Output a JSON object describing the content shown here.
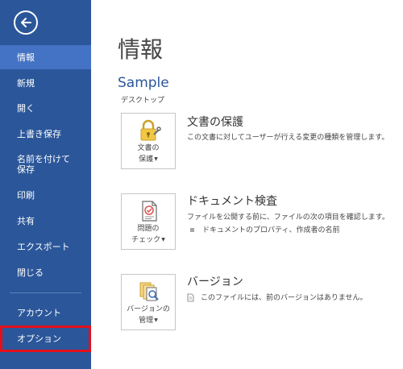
{
  "sidebar": {
    "items": [
      {
        "label": "情報"
      },
      {
        "label": "新規"
      },
      {
        "label": "開く"
      },
      {
        "label": "上書き保存"
      },
      {
        "label_line1": "名前を付けて",
        "label_line2": "保存"
      },
      {
        "label": "印刷"
      },
      {
        "label": "共有"
      },
      {
        "label": "エクスポート"
      },
      {
        "label": "閉じる"
      },
      {
        "label": "アカウント"
      },
      {
        "label": "オプション"
      }
    ]
  },
  "main": {
    "title": "情報",
    "doc_name": "Sample",
    "doc_location": "デスクトップ",
    "sections": [
      {
        "tile_line1": "文書の",
        "tile_line2": "保護",
        "title": "文書の保護",
        "description": "この文書に対してユーザーが行える変更の種類を管理します。"
      },
      {
        "tile_line1": "問題の",
        "tile_line2": "チェック",
        "title": "ドキュメント検査",
        "description": "ファイルを公開する前に、ファイルの次の項目を確認します。",
        "bullet": "ドキュメントのプロパティ、作成者の名前"
      },
      {
        "tile_line1": "バージョンの",
        "tile_line2": "管理",
        "title": "バージョン",
        "description": "このファイルには、前のバージョンはありません。"
      }
    ]
  },
  "colors": {
    "sidebar_bg": "#2b579a",
    "selected_bg": "#4472c4",
    "highlight_border": "#e3101b",
    "accent": "#2b579a"
  },
  "icons": [
    "back-arrow-icon",
    "lock-key-icon",
    "inspect-document-icon",
    "version-history-icon",
    "document-small-icon"
  ]
}
